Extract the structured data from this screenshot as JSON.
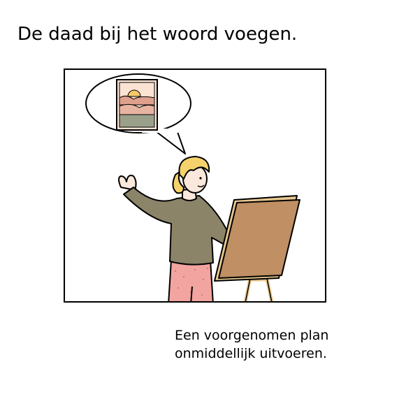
{
  "title": "De daad bij het woord voegen.",
  "caption": {
    "line1": "Een voorgenomen plan",
    "line2": "onmiddellijk uitvoeren."
  },
  "illustration": {
    "icons": [
      "thought-bubble-icon",
      "landscape-painting-icon",
      "person-icon",
      "easel-icon"
    ],
    "colors": {
      "shirt": "#8b8469",
      "pants": "#f2a4a0",
      "hair": "#f5d26b",
      "skin": "#fbe8dc",
      "canvas": "#c08f63",
      "easel": "#e9c88f",
      "sky": "#fbe3d4",
      "sun": "#f5c86a",
      "hills": "#e0a08e",
      "ground": "#9aa08a"
    }
  }
}
